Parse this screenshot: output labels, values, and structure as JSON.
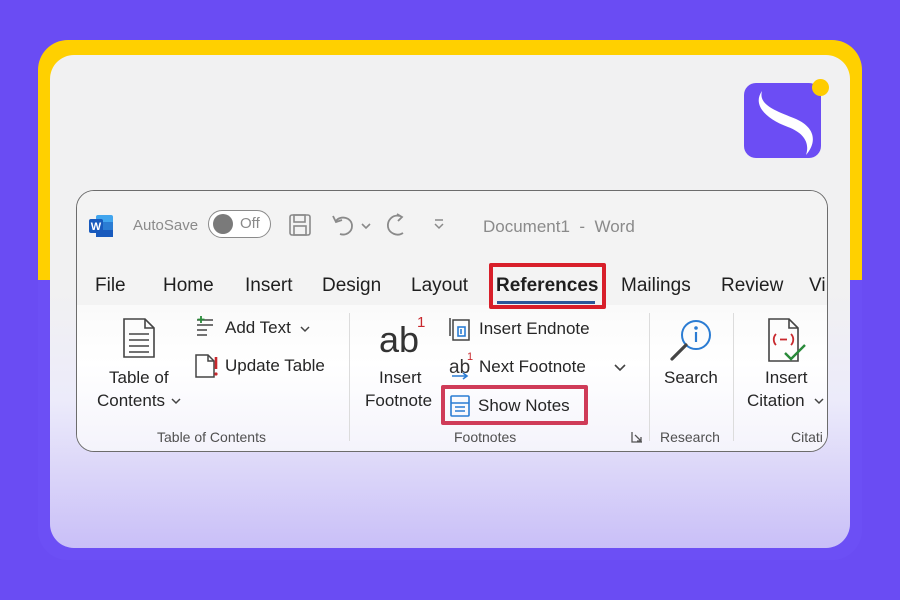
{
  "window": {
    "autosave_label": "AutoSave",
    "autosave_state": "Off",
    "document_title": "Document1  -  Word"
  },
  "tabs": [
    {
      "label": "File"
    },
    {
      "label": "Home"
    },
    {
      "label": "Insert"
    },
    {
      "label": "Design"
    },
    {
      "label": "Layout"
    },
    {
      "label": "References",
      "selected": true
    },
    {
      "label": "Mailings"
    },
    {
      "label": "Review"
    },
    {
      "label": "Vi"
    }
  ],
  "ribbon": {
    "toc": {
      "table_of_contents_line1": "Table of",
      "table_of_contents_line2": "Contents",
      "add_text": "Add Text",
      "update_table": "Update Table",
      "group_label": "Table of Contents"
    },
    "footnotes": {
      "insert_footnote_line1": "Insert",
      "insert_footnote_line2": "Footnote",
      "ab_glyph": "ab",
      "sup_glyph": "1",
      "insert_endnote": "Insert Endnote",
      "next_footnote": "Next Footnote",
      "show_notes": "Show Notes",
      "group_label": "Footnotes"
    },
    "research": {
      "search": "Search",
      "group_label": "Research"
    },
    "citations": {
      "insert_citation_line1": "Insert",
      "insert_citation_line2": "Citation",
      "group_label": "Citati"
    }
  },
  "icons": {
    "word_logo": "W",
    "chevron": "⌄"
  },
  "colors": {
    "background": "#6a4cf3",
    "frame_yellow": "#ffd000",
    "highlight": "#d81f2a",
    "word_blue": "#2b579a",
    "brand_purple": "#6c4df4",
    "brand_dot": "#ffcc00"
  }
}
